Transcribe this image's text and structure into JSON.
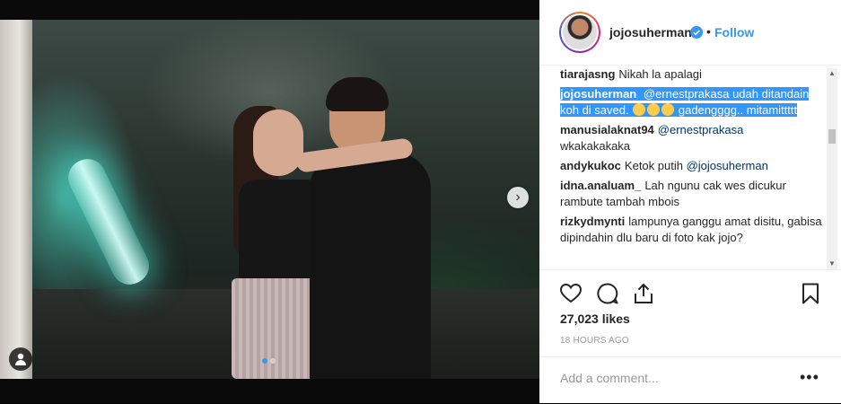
{
  "post": {
    "username": "jojosuherman",
    "follow_label": "Follow",
    "bullet": "•",
    "likes": "27,023 likes",
    "time": "18 HOURS AGO",
    "add_comment_placeholder": "Add a comment...",
    "more_label": "•••",
    "carousel": {
      "current_slide": 1,
      "total_slides": 2,
      "next_arrow": "›"
    }
  },
  "comments": [
    {
      "user": "tiarajasng",
      "text": "Nikah la apalagi"
    },
    {
      "user": "jojosuherman",
      "mention": "@ernestprakasa",
      "text": "udah ditandain koh di saved.",
      "text2": "gadengggg.. mitamittttt",
      "highlighted": true
    },
    {
      "user": "manusialaknat94",
      "mention": "@ernestprakasa",
      "text": "wkakakakaka"
    },
    {
      "user": "andykukoc",
      "text": "Ketok putih",
      "mention": "@jojosuherman"
    },
    {
      "user": "idna.analuam_",
      "text": "Lah ngunu cak wes dicukur rambute tambah mbois"
    },
    {
      "user": "rizkydmynti",
      "text": "lampunya ganggu amat disitu, gabisa dipindahin dlu baru di foto kak jojo?"
    }
  ],
  "icons": {
    "verified": "verified-badge-icon",
    "like": "heart-icon",
    "comment": "comment-bubble-icon",
    "share": "share-icon",
    "save": "bookmark-icon",
    "tag": "person-tag-icon"
  },
  "colors": {
    "accent": "#3897f0",
    "selection": "#3297fd",
    "text": "#262626",
    "muted": "#999999"
  }
}
